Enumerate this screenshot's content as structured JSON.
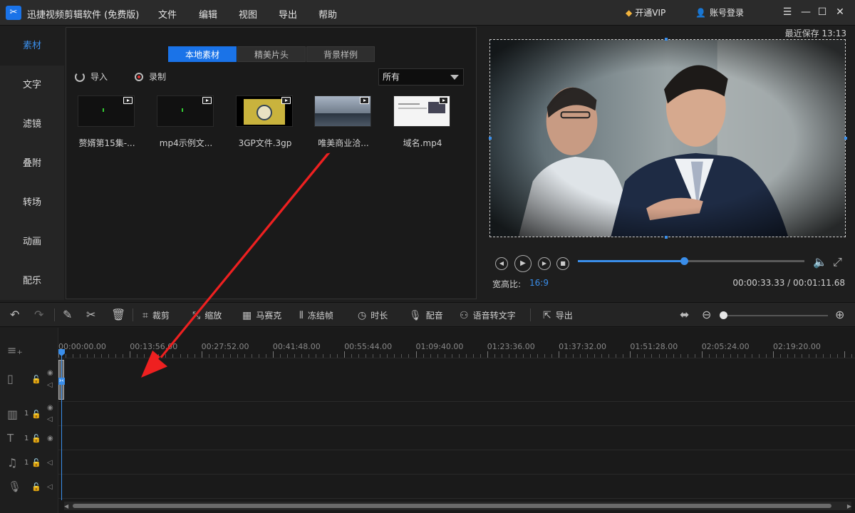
{
  "title_bar": {
    "app_title": "迅捷视频剪辑软件 (免费版)",
    "menus": [
      "文件",
      "编辑",
      "视图",
      "导出",
      "帮助"
    ],
    "vip_label": "开通VIP",
    "login_label": "账号登录"
  },
  "left_nav": [
    "素材",
    "文字",
    "滤镜",
    "叠附",
    "转场",
    "动画",
    "配乐"
  ],
  "library": {
    "tabs": [
      "本地素材",
      "精美片头",
      "背景样例"
    ],
    "import_label": "导入",
    "record_label": "录制",
    "filter_value": "所有",
    "clips": [
      "赘婿第15集-...",
      "mp4示例文...",
      "3GP文件.3gp",
      "唯美商业洽...",
      "域名.mp4"
    ]
  },
  "preview": {
    "autosave": "最近保存 13:13",
    "progress_fraction": 0.47,
    "ratio_label": "宽高比:",
    "ratio_value": "16:9",
    "timecode": "00:00:33.33 / 00:01:11.68"
  },
  "toolbar": {
    "crop": "裁剪",
    "zoom": "缩放",
    "mosaic": "马赛克",
    "freeze": "冻结帧",
    "duration": "时长",
    "dub": "配音",
    "speech_to_text": "语音转文字",
    "export": "导出",
    "zoom_fraction": 0.0
  },
  "timeline": {
    "ticks": [
      "00:00:00.00",
      "00:13:56.00",
      "00:27:52.00",
      "00:41:48.00",
      "00:55:44.00",
      "01:09:40.00",
      "01:23:36.00",
      "01:37:32.00",
      "01:51:28.00",
      "02:05:24.00",
      "02:19:20.00"
    ],
    "track_counts": [
      "1",
      "1",
      "1"
    ]
  }
}
